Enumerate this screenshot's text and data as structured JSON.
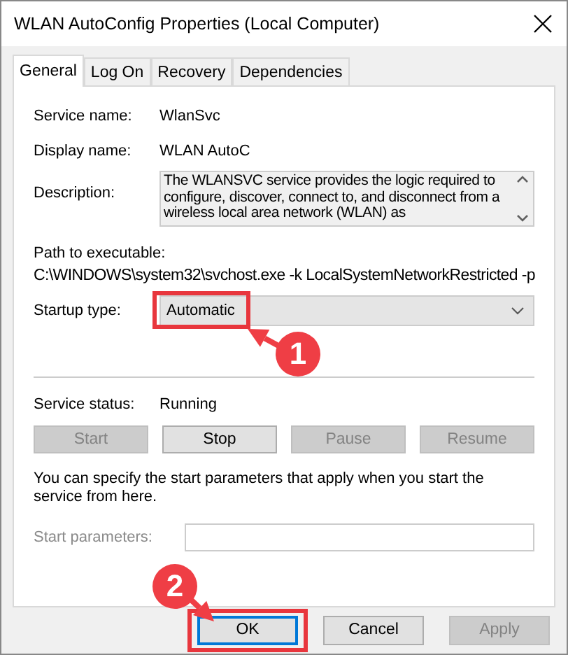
{
  "window": {
    "title": "WLAN AutoConfig Properties (Local Computer)"
  },
  "tabs": [
    {
      "label": "General",
      "selected": true
    },
    {
      "label": "Log On",
      "selected": false
    },
    {
      "label": "Recovery",
      "selected": false
    },
    {
      "label": "Dependencies",
      "selected": false
    }
  ],
  "service_name": {
    "label": "Service name:",
    "value": "WlanSvc"
  },
  "display_name": {
    "label": "Display name:",
    "value": "WLAN AutoC"
  },
  "description": {
    "label": "Description:",
    "value": "The WLANSVC service provides the logic required to configure, discover, connect to, and disconnect from a wireless local area network (WLAN) as"
  },
  "path": {
    "label": "Path to executable:",
    "value": "C:\\WINDOWS\\system32\\svchost.exe -k LocalSystemNetworkRestricted -p"
  },
  "startup_type": {
    "label": "Startup type:",
    "value": "Automatic",
    "highlighted": true
  },
  "service_status": {
    "label": "Service status:",
    "value": "Running"
  },
  "service_buttons": [
    {
      "label": "Start",
      "disabled": true
    },
    {
      "label": "Stop",
      "disabled": false
    },
    {
      "label": "Pause",
      "disabled": true
    },
    {
      "label": "Resume",
      "disabled": true
    }
  ],
  "hint": "You can specify the start parameters that apply when you start the service from here.",
  "start_parameters": {
    "label": "Start parameters:",
    "disabled": true
  },
  "dialog_buttons": [
    {
      "label": "OK",
      "disabled": false,
      "default": true,
      "highlighted": true
    },
    {
      "label": "Cancel",
      "disabled": false,
      "default": false,
      "highlighted": false
    },
    {
      "label": "Apply",
      "disabled": true,
      "default": false,
      "highlighted": false
    }
  ],
  "annotations": [
    {
      "kind": "step",
      "label": "1"
    },
    {
      "kind": "step",
      "label": "2"
    }
  ]
}
